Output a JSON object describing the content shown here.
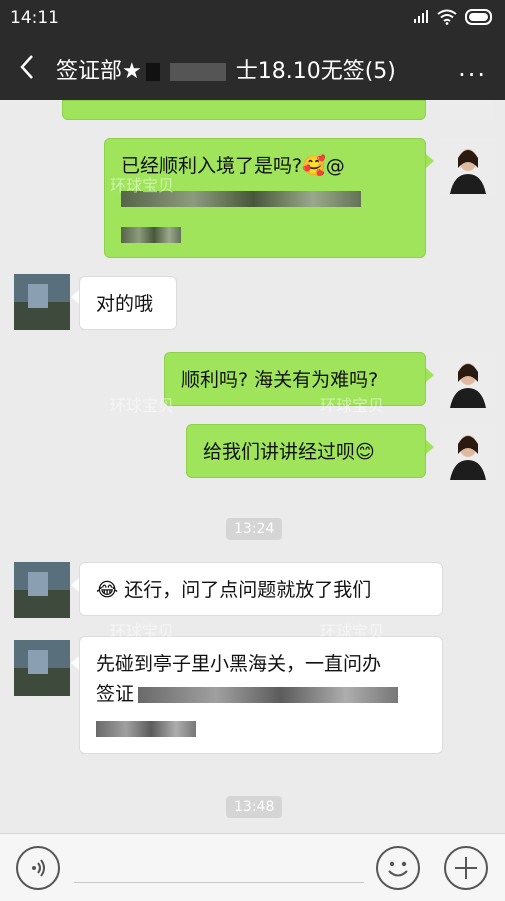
{
  "status": {
    "time": "14:11"
  },
  "nav": {
    "title_prefix": "签证部★",
    "title_suffix": "士18.10无签(5)",
    "more": "..."
  },
  "messages": [
    {
      "side": "right",
      "text": "已经顺利入境了是吗?🥰@"
    },
    {
      "side": "left",
      "text": "对的哦"
    },
    {
      "side": "right",
      "text": "顺利吗? 海关有为难吗?"
    },
    {
      "side": "right",
      "text": "给我们讲讲经过呗😊"
    },
    {
      "side": "left",
      "text": "😂 还行，问了点问题就放了我们"
    },
    {
      "side": "left",
      "text": "先碰到亭子里小黑海关，一直问办",
      "line2": "签证"
    }
  ],
  "timestamps": [
    "13:24",
    "13:48"
  ],
  "watermark": "环球宝贝",
  "colors": {
    "green_bubble": "#9fe45a",
    "bg": "#ebebeb",
    "nav": "#2b2b2b"
  }
}
